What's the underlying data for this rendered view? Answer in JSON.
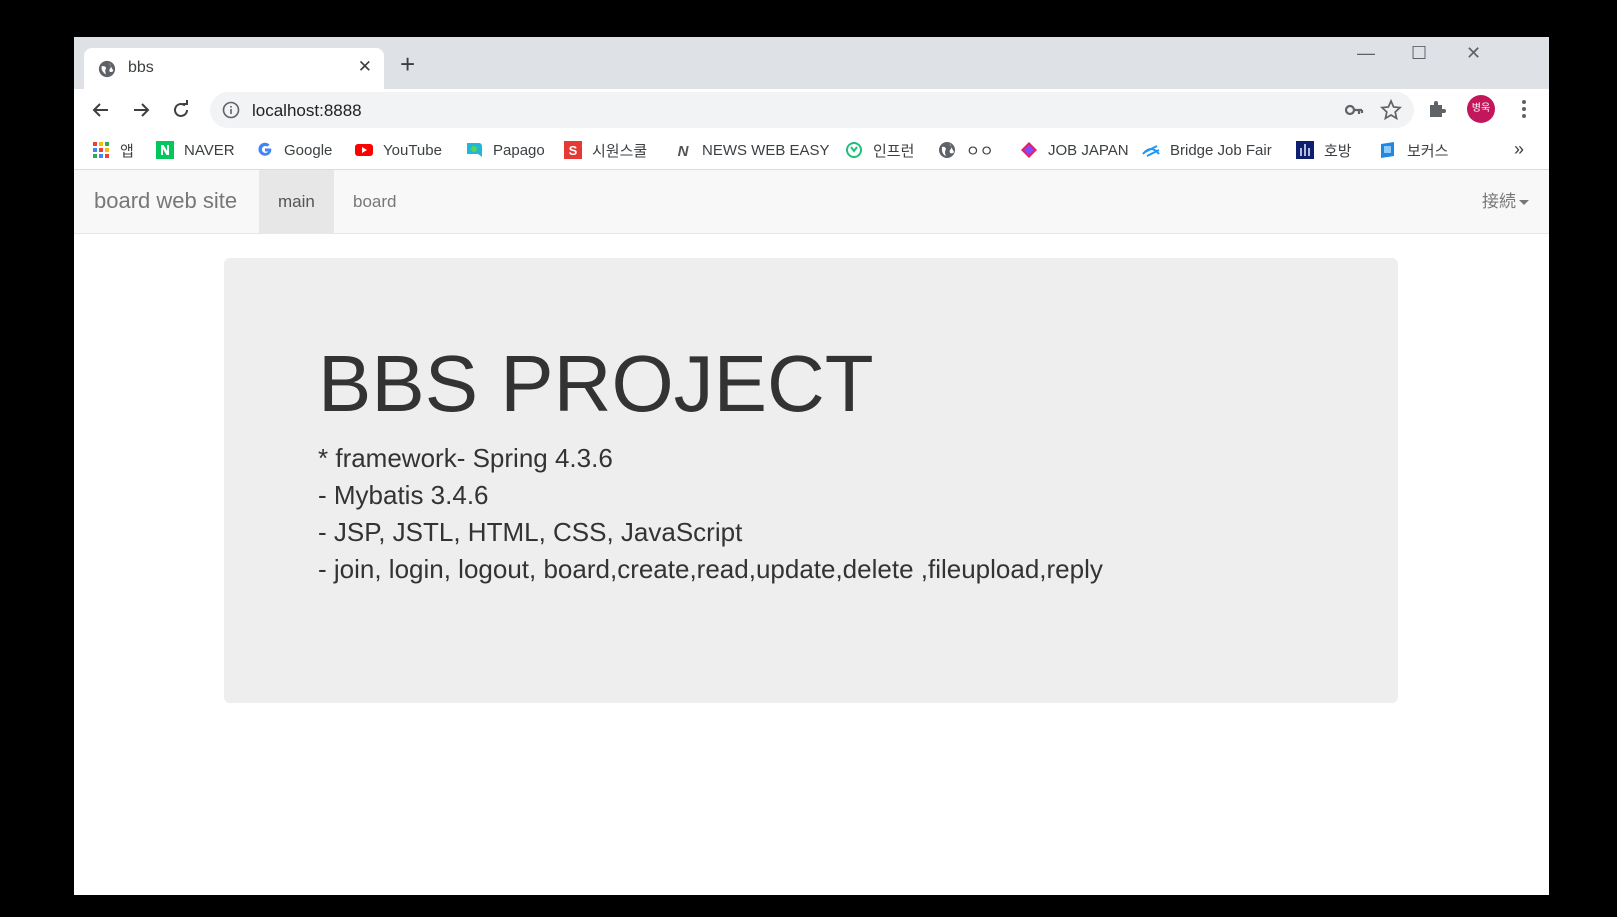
{
  "browser": {
    "tab_title": "bbs",
    "tab_close": "✕",
    "new_tab": "+",
    "url": "localhost:8888",
    "avatar_text": "병욱",
    "window_controls": {
      "minimize": "—",
      "maximize": "☐",
      "close": "✕"
    }
  },
  "bookmarks": {
    "items": [
      {
        "label": "앱",
        "icon": "apps-grid-icon"
      },
      {
        "label": "NAVER",
        "icon": "naver-icon",
        "color": "#03c75a"
      },
      {
        "label": "Google",
        "icon": "google-icon"
      },
      {
        "label": "YouTube",
        "icon": "youtube-icon",
        "color": "#ff0000"
      },
      {
        "label": "Papago",
        "icon": "papago-icon"
      },
      {
        "label": "시원스쿨",
        "icon": "siwonschool-icon",
        "color": "#e53935"
      },
      {
        "label": "NEWS WEB EASY",
        "icon": "nhk-icon"
      },
      {
        "label": "인프런",
        "icon": "inflearn-icon",
        "color": "#1dc078"
      },
      {
        "label": "ㅇㅇ",
        "icon": "globe-icon"
      },
      {
        "label": "JOB JAPAN",
        "icon": "jobjapan-icon"
      },
      {
        "label": "Bridge Job Fair",
        "icon": "bridge-icon",
        "color": "#2196f3"
      },
      {
        "label": "호방",
        "icon": "hobang-icon",
        "color": "#0d1f6e"
      },
      {
        "label": "보커스",
        "icon": "bookmark-icon",
        "color": "#1e88e5"
      }
    ],
    "more": "»"
  },
  "site": {
    "brand": "board web site",
    "nav": {
      "main": "main",
      "board": "board"
    },
    "connect": "接続"
  },
  "jumbotron": {
    "title": "BBS PROJECT",
    "lines": [
      "* framework- Spring 4.3.6",
      "- Mybatis 3.4.6",
      "- JSP, JSTL, HTML, CSS, JavaScript",
      "- join, login, logout, board,create,read,update,delete ,fileupload,reply"
    ]
  },
  "colors": {
    "navbar_bg": "#f8f8f8",
    "jumbotron_bg": "#eeeeee",
    "avatar_bg": "#c2185b"
  }
}
